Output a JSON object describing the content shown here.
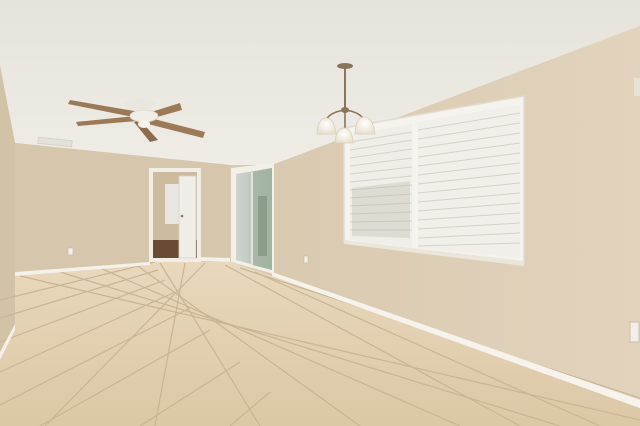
{
  "scene": {
    "kind": "photo",
    "subject": "empty-room-interior",
    "colors": {
      "ceiling": "#ebe8e2",
      "wall_left": "#d6c6ac",
      "wall_back": "#d3c2a7",
      "wall_right": "#dcccb4",
      "floor": "#e2cfb1",
      "grout": "#c8b494",
      "baseboard": "#f4f1ea",
      "fan_blade": "#9c7a58",
      "fixture_metal": "#8a7558",
      "glass_shade": "#f7f3e8",
      "blinds": "#f2f0ea",
      "hallway_floor": "#6a4a32"
    }
  }
}
